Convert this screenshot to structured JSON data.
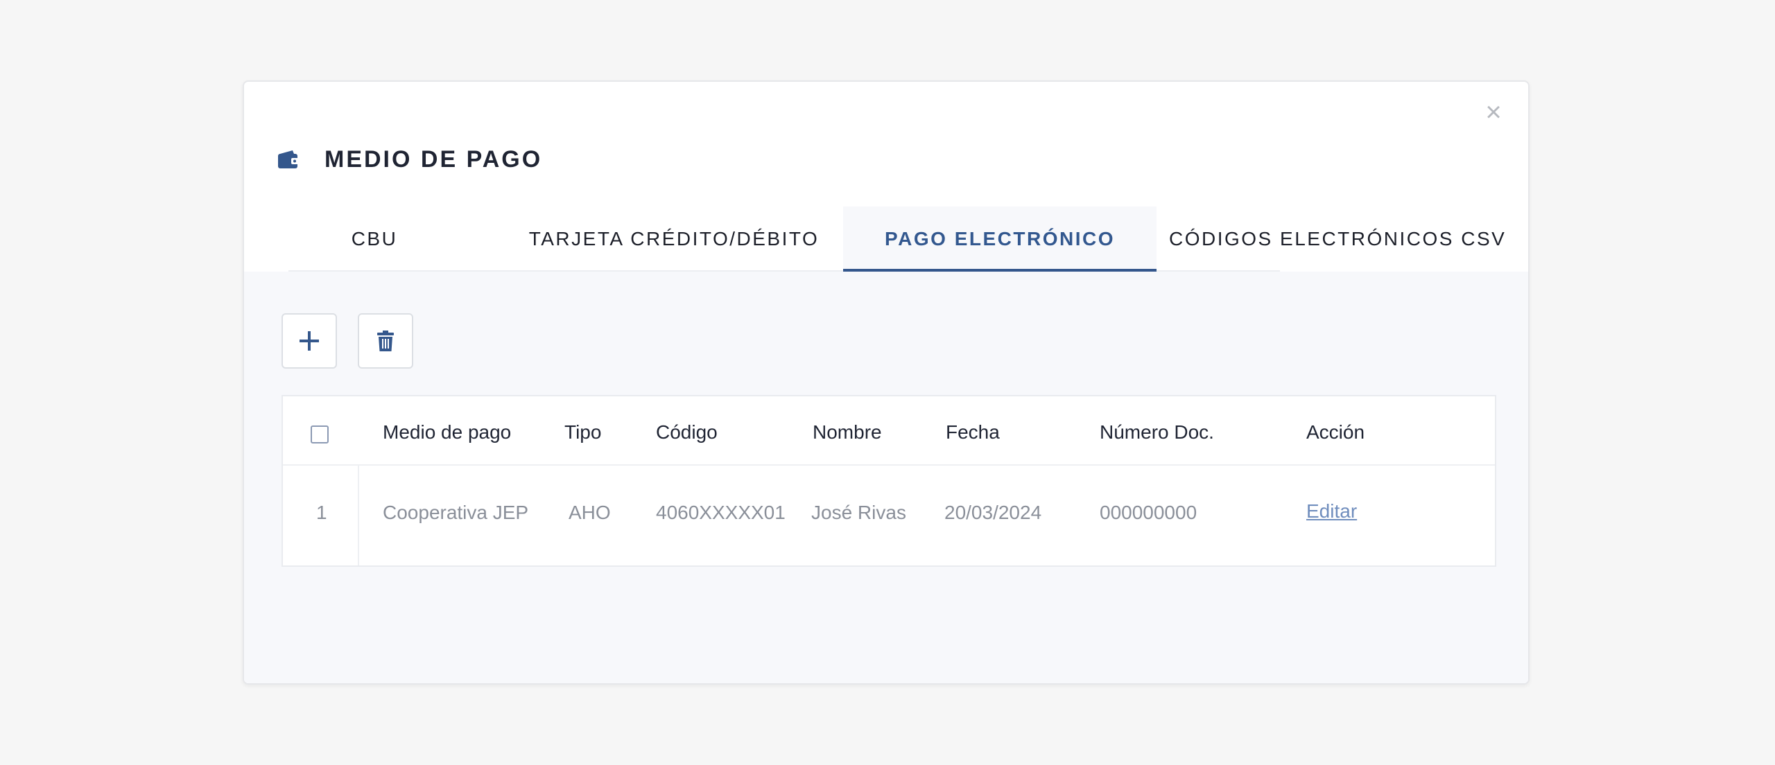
{
  "modal": {
    "title": "MEDIO DE PAGO",
    "close_label": "×"
  },
  "tabs": [
    {
      "label": "CBU"
    },
    {
      "label": "TARJETA CRÉDITO/DÉBITO"
    },
    {
      "label": "PAGO ELECTRÓNICO",
      "active": true
    },
    {
      "label": "CÓDIGOS ELECTRÓNICOS CSV"
    }
  ],
  "toolbar": {
    "add_icon": "plus-icon",
    "delete_icon": "trash-icon"
  },
  "table": {
    "headers": [
      "Medio de pago",
      "Tipo",
      "Código",
      "Nombre",
      "Fecha",
      "Número Doc.",
      "Acción"
    ],
    "rows": [
      {
        "index": "1",
        "medio_de_pago": "Cooperativa JEP",
        "tipo": "AHO",
        "codigo": "4060XXXXX01",
        "nombre": "José Rivas",
        "fecha": "20/03/2024",
        "numero_doc": "000000000",
        "accion": "Editar"
      }
    ]
  },
  "colors": {
    "accent": "#34578c",
    "link": "#6f8dbd",
    "muted_text": "#8a8f99",
    "background": "#f6f6f6"
  }
}
